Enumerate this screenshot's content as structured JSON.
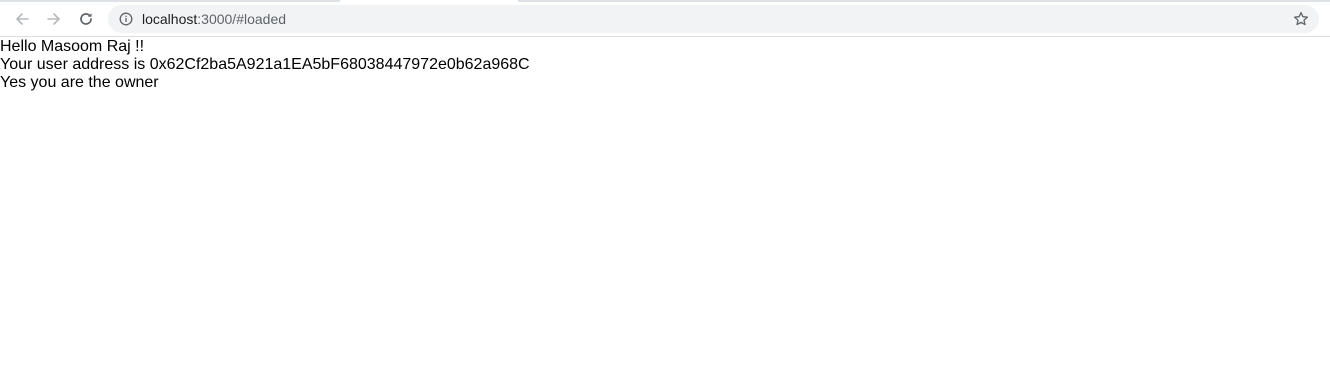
{
  "browser": {
    "url_host": "localhost",
    "url_path": ":3000/#loaded",
    "icons": {
      "back": "arrow-left-icon",
      "forward": "arrow-right-icon",
      "reload": "reload-icon",
      "info": "info-circle-icon",
      "bookmark": "star-icon"
    }
  },
  "page": {
    "greeting": "Hello Masoom Raj !!",
    "address_line": "Your user address is 0x62Cf2ba5A921a1EA5bF68038447972e0b62a968C",
    "owner_line": "Yes you are the owner"
  }
}
